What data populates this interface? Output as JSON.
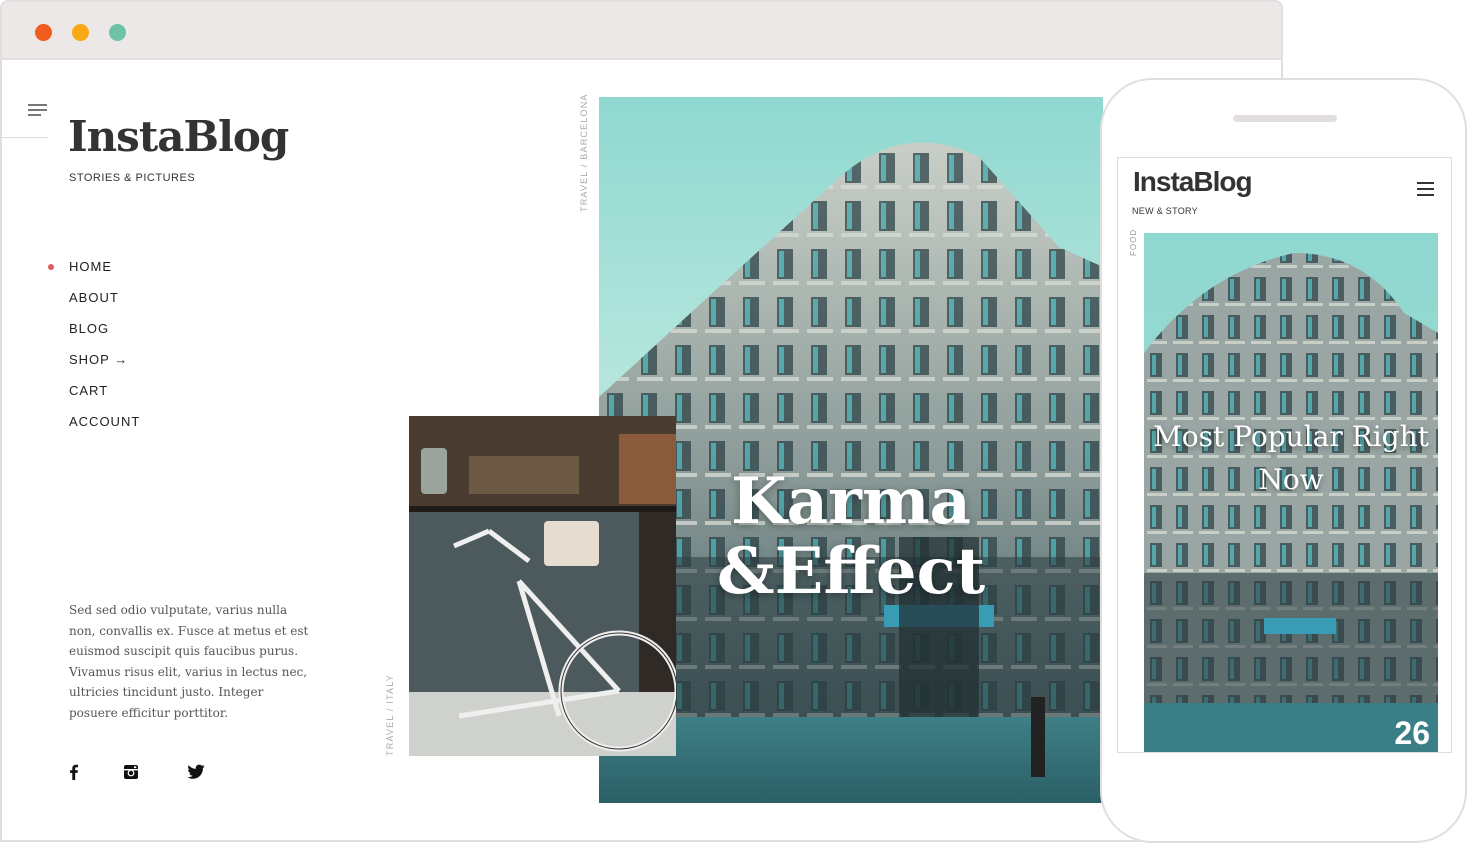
{
  "colors": {
    "dot_red": "#f25c1f",
    "dot_yellow": "#f7a916",
    "dot_green": "#6cc3a6",
    "accent": "#e05b5b",
    "sky": "#9fd9cf",
    "building": "#3f5a5e"
  },
  "icons": {
    "menu": "hamburger-icon",
    "arrow": "arrow-right-icon",
    "facebook": "facebook-icon",
    "instagram": "instagram-icon",
    "twitter": "twitter-icon"
  },
  "site": {
    "logo": "InstaBlog",
    "tagline": "STORIES & PICTURES"
  },
  "nav": {
    "items": [
      {
        "label": "HOME",
        "active": true
      },
      {
        "label": "ABOUT"
      },
      {
        "label": "BLOG"
      },
      {
        "label": "SHOP →"
      },
      {
        "label": "CART"
      },
      {
        "label": "ACCOUNT"
      }
    ]
  },
  "blurb": "Sed sed odio vulputate, varius nulla non, convallis ex. Fusce at metus et est euismod suscipit quis faucibus purus. Vivamus risus elit, varius in lectus nec, ultricies tincidunt justo. Integer posuere efficitur porttitor.",
  "labels": {
    "barcelona": "TRAVEL / BARCELONA",
    "italy": "TRAVEL / ITALY"
  },
  "hero": {
    "title_line1": "Karma",
    "title_line2": "&Effect"
  },
  "mobile": {
    "logo": "InstaBlog",
    "tagline": "NEW & STORY",
    "category": "FOOD",
    "title": "Most Popular Right Now",
    "count": "26"
  }
}
